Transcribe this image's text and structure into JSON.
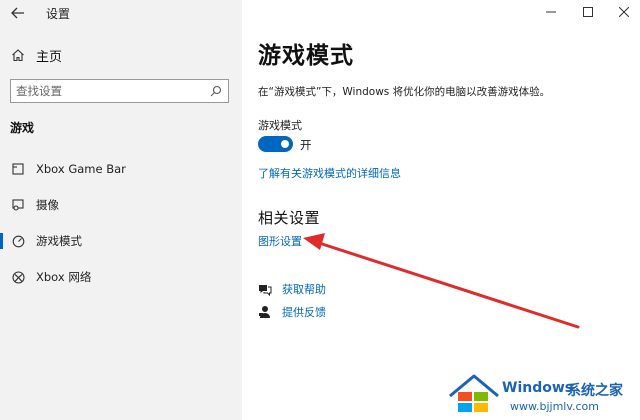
{
  "app": {
    "title": "设置",
    "back_icon": "back-arrow-icon"
  },
  "sidebar": {
    "home_label": "主页",
    "search_placeholder": "查找设置",
    "section_title": "游戏",
    "items": [
      {
        "label": "Xbox Game Bar",
        "icon": "xbox-game-bar-icon",
        "active": false
      },
      {
        "label": "摄像",
        "icon": "captures-icon",
        "active": false
      },
      {
        "label": "游戏模式",
        "icon": "game-mode-icon",
        "active": true
      },
      {
        "label": "Xbox 网络",
        "icon": "xbox-icon",
        "active": false
      }
    ]
  },
  "main": {
    "title": "游戏模式",
    "description": "在“游戏模式”下，Windows 将优化你的电脑以改善游戏体验。",
    "toggle": {
      "label": "游戏模式",
      "state": "开",
      "on": true
    },
    "learn_more": "了解有关游戏模式的详细信息",
    "related_title": "相关设置",
    "related_link": "图形设置",
    "help": {
      "get_help": "获取帮助",
      "feedback": "提供反馈"
    }
  },
  "window_controls": [
    "minimize-icon",
    "maximize-icon",
    "close-icon"
  ],
  "watermark": {
    "brand": "Windows",
    "suffix": "系统之家",
    "url": "www.bjjmlv.com"
  },
  "colors": {
    "accent": "#0067c0",
    "sidebar_bg": "#f2f2f2",
    "annotation_arrow": "#e02b2b",
    "watermark": "#1b63b7"
  }
}
